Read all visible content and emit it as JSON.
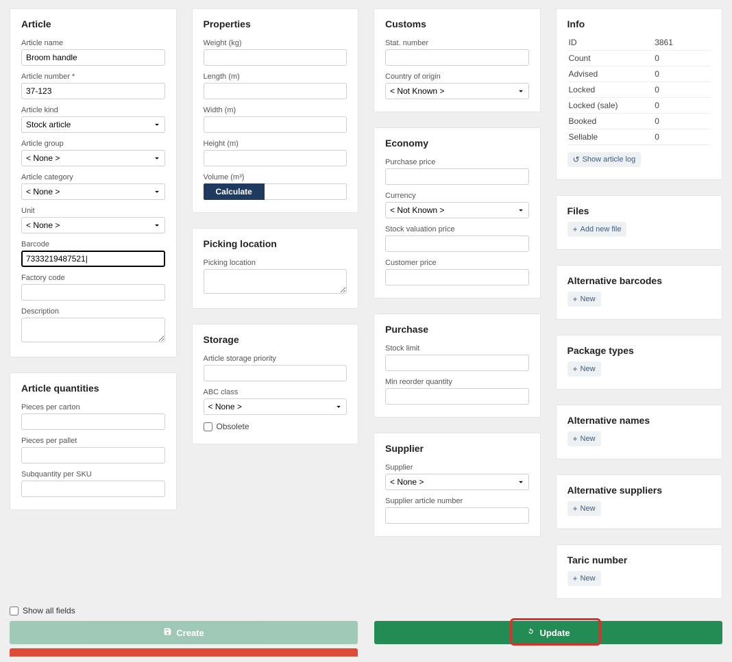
{
  "article": {
    "title": "Article",
    "name_label": "Article name",
    "name_value": "Broom handle",
    "number_label": "Article number *",
    "number_value": "37-123",
    "kind_label": "Article kind",
    "kind_value": "Stock article",
    "group_label": "Article group",
    "group_value": "< None >",
    "category_label": "Article category",
    "category_value": "< None >",
    "unit_label": "Unit",
    "unit_value": "< None >",
    "barcode_label": "Barcode",
    "barcode_value": "7333219487521|",
    "factory_label": "Factory code",
    "description_label": "Description"
  },
  "quantities": {
    "title": "Article quantities",
    "pieces_carton_label": "Pieces per carton",
    "pieces_pallet_label": "Pieces per pallet",
    "subqty_label": "Subquantity per SKU"
  },
  "properties": {
    "title": "Properties",
    "weight_label": "Weight (kg)",
    "length_label": "Length (m)",
    "width_label": "Width (m)",
    "height_label": "Height (m)",
    "volume_label": "Volume (m³)",
    "calculate_label": "Calculate"
  },
  "picking": {
    "title": "Picking location",
    "location_label": "Picking location"
  },
  "storage": {
    "title": "Storage",
    "priority_label": "Article storage priority",
    "abc_label": "ABC class",
    "abc_value": "< None >",
    "obsolete_label": "Obsolete"
  },
  "customs": {
    "title": "Customs",
    "stat_label": "Stat. number",
    "country_label": "Country of origin",
    "country_value": "< Not Known >"
  },
  "economy": {
    "title": "Economy",
    "purchase_label": "Purchase price",
    "currency_label": "Currency",
    "currency_value": "< Not Known >",
    "stockval_label": "Stock valuation price",
    "customer_label": "Customer price"
  },
  "purchase": {
    "title": "Purchase",
    "stocklimit_label": "Stock limit",
    "minreorder_label": "Min reorder quantity"
  },
  "supplier": {
    "title": "Supplier",
    "supplier_label": "Supplier",
    "supplier_value": "< None >",
    "artnum_label": "Supplier article number"
  },
  "info": {
    "title": "Info",
    "rows": [
      {
        "k": "ID",
        "v": "3861"
      },
      {
        "k": "Count",
        "v": "0"
      },
      {
        "k": "Advised",
        "v": "0"
      },
      {
        "k": "Locked",
        "v": "0"
      },
      {
        "k": "Locked (sale)",
        "v": "0"
      },
      {
        "k": "Booked",
        "v": "0"
      },
      {
        "k": "Sellable",
        "v": "0"
      }
    ],
    "show_log": "Show article log"
  },
  "files": {
    "title": "Files",
    "add_label": "Add new file"
  },
  "alt_barcodes": {
    "title": "Alternative barcodes",
    "new_label": "New"
  },
  "package_types": {
    "title": "Package types",
    "new_label": "New"
  },
  "alt_names": {
    "title": "Alternative names",
    "new_label": "New"
  },
  "alt_suppliers": {
    "title": "Alternative suppliers",
    "new_label": "New"
  },
  "taric": {
    "title": "Taric number",
    "new_label": "New"
  },
  "footer": {
    "show_all_label": "Show all fields",
    "create_label": "Create",
    "update_label": "Update"
  }
}
